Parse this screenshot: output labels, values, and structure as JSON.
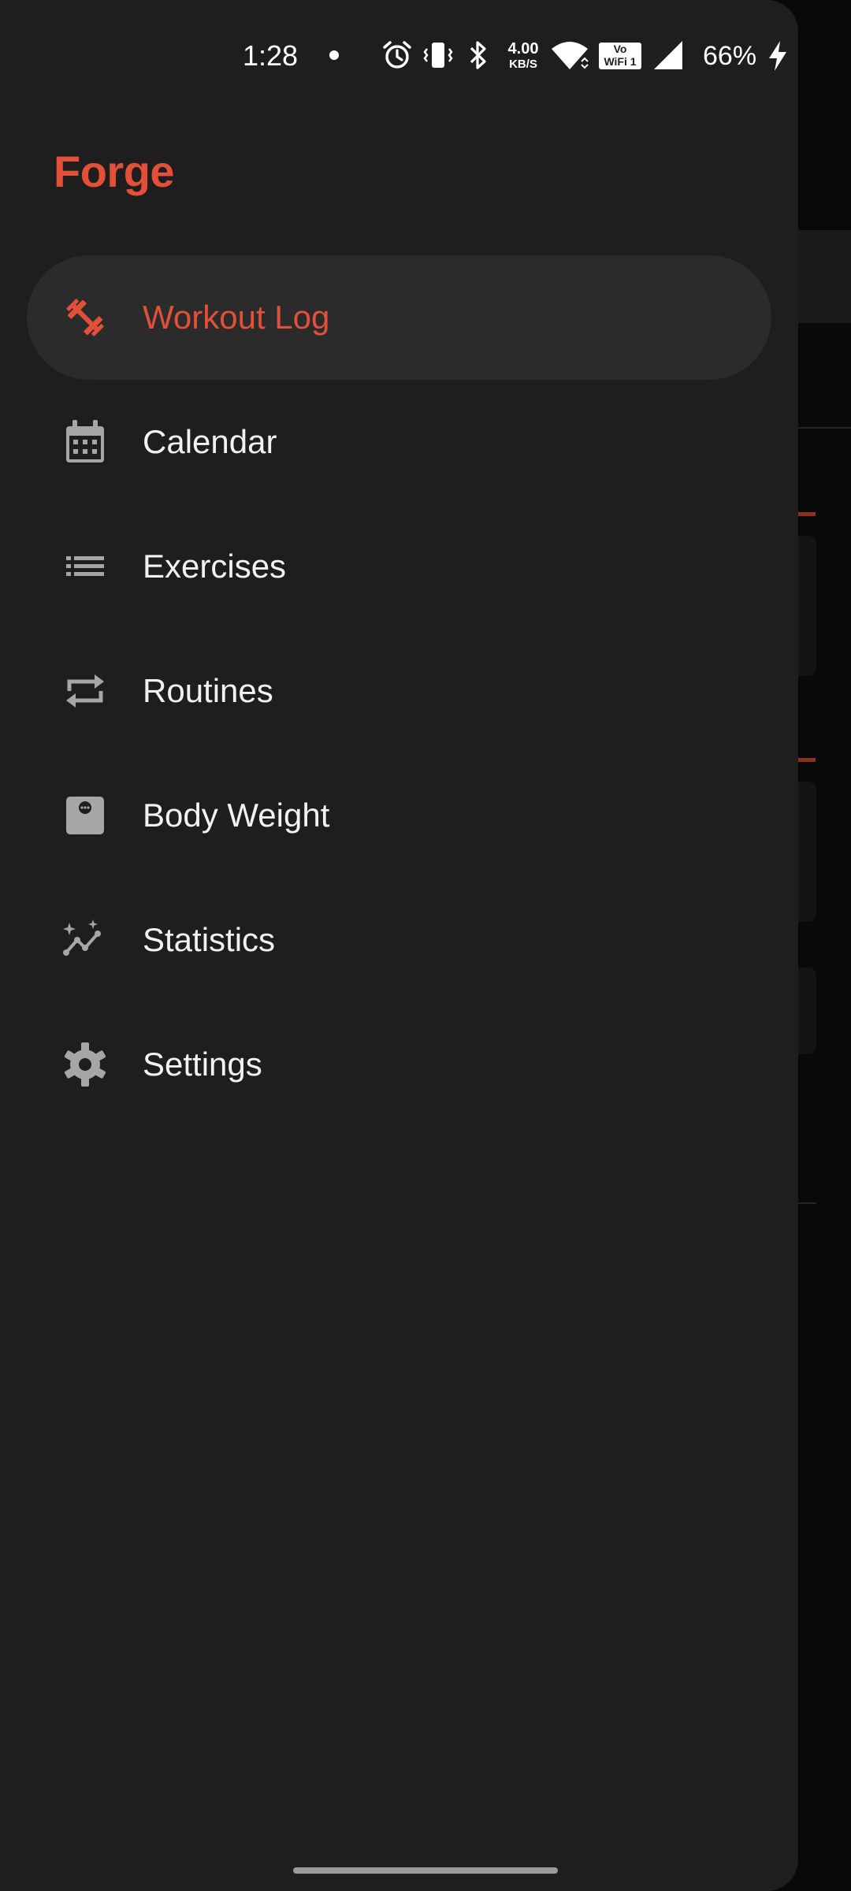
{
  "status_bar": {
    "time": "1:28",
    "network_speed_value": "4.00",
    "network_speed_unit": "KB/S",
    "volte_top": "Vo",
    "volte_bottom": "WiFi 1",
    "battery": "66%"
  },
  "app": {
    "title": "Forge",
    "accent_color": "#e2503a"
  },
  "menu": {
    "active_index": 0,
    "items": [
      {
        "label": "Workout Log",
        "icon": "dumbbell-icon"
      },
      {
        "label": "Calendar",
        "icon": "calendar-icon"
      },
      {
        "label": "Exercises",
        "icon": "list-icon"
      },
      {
        "label": "Routines",
        "icon": "repeat-icon"
      },
      {
        "label": "Body Weight",
        "icon": "scale-icon"
      },
      {
        "label": "Statistics",
        "icon": "stats-icon"
      },
      {
        "label": "Settings",
        "icon": "gear-icon"
      }
    ]
  }
}
